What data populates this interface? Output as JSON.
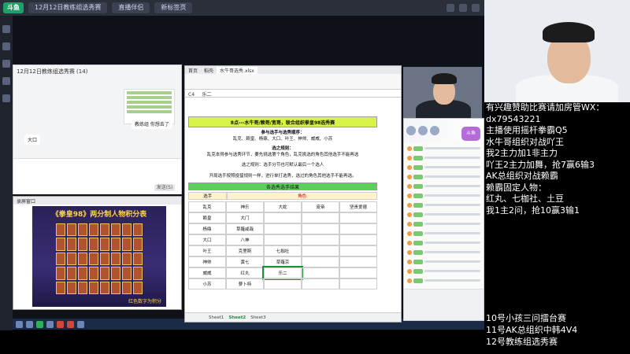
{
  "topbar": {
    "logo": "斗鱼",
    "tabs": [
      "12月12日教练组选秀赛",
      "直播伴侣",
      "新标签页"
    ]
  },
  "chat": {
    "title": "12月12日教练组选秀赛 (14)",
    "bubble_right": "教练组 你想去了",
    "bubble_left": "大口",
    "send": "发送(S)"
  },
  "game": {
    "window_title": "录屏窗口",
    "poster_title": "《拳皇98》两分制人物积分表",
    "poster_footer": "红色数字为积分"
  },
  "excel": {
    "tabs": [
      "首页",
      "稻壳",
      "水牛哥选秀.xlsx"
    ],
    "cell_ref": "C4",
    "formula": "乐二",
    "title": "8点---水牛哥/赖哥/宽哥，联合组织拳皇98选秀赛",
    "rules_head": "参与选手与选秀顺序：",
    "rules_order": "乱克、赖皇、杨鼎、大口、叶王、神帅、威威、小苏",
    "hdr2": "选之规则：",
    "rule2": "乱克本得参与选秀环节，要先挑选第个角色，乱克挑选的角色其他选手不能再选",
    "hdr3": "选之规则：选手分节也可默认最后一个选人",
    "rule3": "开局选手按照投猛规则一样，进行单打选秀，选过的角色其他选手不能再选。",
    "section_header": "各选秀选手结果",
    "col_head": [
      "选手",
      "角色"
    ],
    "rows": [
      [
        "乱克",
        "神乐",
        "大蛇",
        "庞帝",
        "坚贵爱德"
      ],
      [
        "赖皇",
        "大门",
        "",
        "",
        ""
      ],
      [
        "杨鼎",
        "草薙咸哉",
        "",
        "",
        ""
      ],
      [
        "大口",
        "八神",
        "",
        "",
        ""
      ],
      [
        "叶王",
        "克里斯",
        "七枷社",
        "",
        ""
      ],
      [
        "神帅",
        "黄七",
        "草薙京",
        "",
        ""
      ],
      [
        "威威",
        "红丸",
        "乐二",
        "",
        ""
      ],
      [
        "小苏",
        "萝卜特",
        "",
        "",
        ""
      ]
    ],
    "sheets": [
      "Sheet1",
      "Sheet2",
      "Sheet3"
    ],
    "active_sheet": "Sheet2"
  },
  "liveroom": {
    "badge": "斗鱼"
  },
  "overlay": {
    "lines": [
      "有兴趣赞助比赛请加房管WX：",
      "dx79543221",
      "主播使用摇杆拳霸Q5",
      "水牛哥组织对战吖王",
      "我2主力加1非主力",
      "吖王2主力加舞，抢7赢6输3",
      "AK总组织对战赖霸",
      "赖霸固定人物：",
      "红丸、七枷社、土豆",
      "我1主2问，抢10赢3输1"
    ],
    "schedule": [
      "10号小孩三问擂台赛",
      "11号AK总组织中韩4V4",
      "12号教练组选秀赛"
    ]
  }
}
